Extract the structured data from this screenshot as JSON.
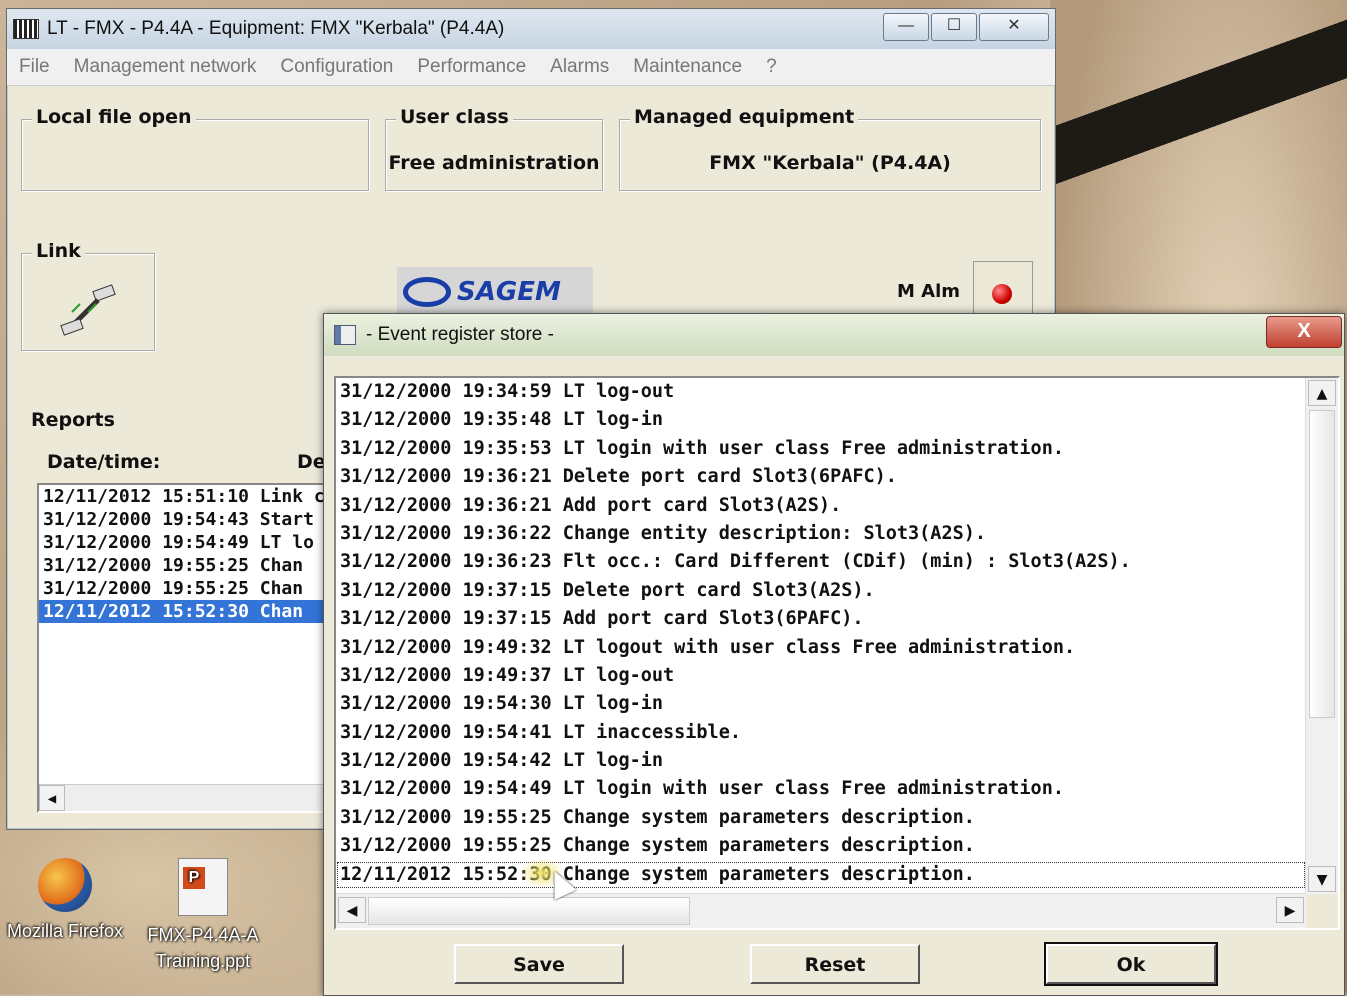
{
  "main_window": {
    "title": "LT - FMX - P4.4A - Equipment: FMX \"Kerbala\" (P4.4A)",
    "controls": {
      "minimize": "—",
      "maximize": "☐",
      "close": "✕"
    },
    "menu": [
      "File",
      "Management network",
      "Configuration",
      "Performance",
      "Alarms",
      "Maintenance",
      "?"
    ],
    "local_file": {
      "legend": "Local file open",
      "value": ""
    },
    "user_class": {
      "legend": "User class",
      "value": "Free administration"
    },
    "managed_equipment": {
      "legend": "Managed equipment",
      "value": "FMX \"Kerbala\" (P4.4A)"
    },
    "link": {
      "legend": "Link"
    },
    "brand": "SAGEM",
    "m_alm_label": "M Alm",
    "reports": {
      "title": "Reports",
      "date_header": "Date/time:",
      "desc_header": "De",
      "rows": [
        "12/11/2012  15:51:10  Link c",
        "31/12/2000  19:54:43  Start",
        "31/12/2000  19:54:49  LT lo",
        "31/12/2000  19:55:25  Chan",
        "31/12/2000  19:55:25  Chan",
        "12/11/2012  15:52:30  Chan"
      ],
      "selected_index": 5
    }
  },
  "event_dialog": {
    "title": "- Event register store -",
    "close": "X",
    "events": [
      "31/12/2000  19:34:59  LT log-out",
      "31/12/2000  19:35:48  LT log-in",
      "31/12/2000  19:35:53  LT login with user class Free administration.",
      "31/12/2000  19:36:21  Delete port card Slot3(6PAFC).",
      "31/12/2000  19:36:21  Add port card Slot3(A2S).",
      "31/12/2000  19:36:22  Change entity description: Slot3(A2S).",
      "31/12/2000  19:36:23  Flt occ.: Card Different (CDif) (min) : Slot3(A2S).",
      "31/12/2000  19:37:15  Delete port card Slot3(A2S).",
      "31/12/2000  19:37:15  Add port card Slot3(6PAFC).",
      "31/12/2000  19:49:32  LT logout with user class Free administration.",
      "31/12/2000  19:49:37  LT log-out",
      "31/12/2000  19:54:30  LT log-in",
      "31/12/2000  19:54:41  LT inaccessible.",
      "31/12/2000  19:54:42  LT log-in",
      "31/12/2000  19:54:49  LT login with user class Free administration.",
      "31/12/2000  19:55:25  Change system parameters description.",
      "31/12/2000  19:55:25  Change system parameters description.",
      "12/11/2012  15:52:30  Change system parameters description."
    ],
    "focused_index": 17,
    "buttons": {
      "save": "Save",
      "reset": "Reset",
      "ok": "Ok"
    }
  },
  "desktop_icons": [
    {
      "label": "Mozilla Firefox",
      "icon": "firefox-icon"
    },
    {
      "label": "FMX-P4.4A-A Training.ppt",
      "icon": "powerpoint-file-icon"
    }
  ]
}
